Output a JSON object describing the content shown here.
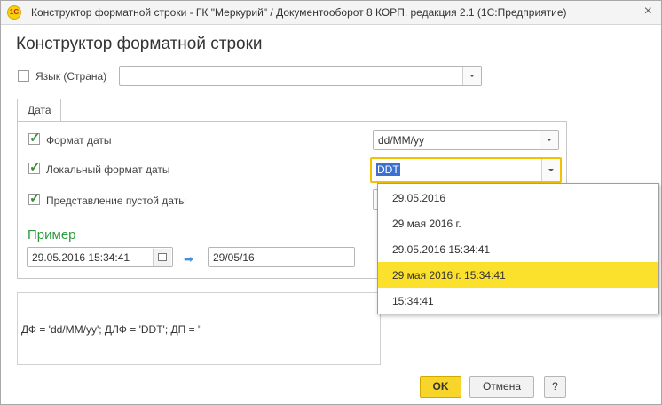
{
  "window": {
    "title": "Конструктор форматной строки - ГК \"Меркурий\" / Документооборот 8 КОРП, редакция 2.1  (1С:Предприятие)",
    "app_icon": "1С",
    "close_glyph": "×"
  },
  "form": {
    "title": "Конструктор форматной строки"
  },
  "language": {
    "label": "Язык (Страна)",
    "value": ""
  },
  "tabs": [
    {
      "label": "Дата"
    }
  ],
  "date_format": {
    "label": "Формат даты",
    "value": "dd/MM/yy",
    "checked": true
  },
  "local_date_format": {
    "label": "Локальный формат даты",
    "value": "DDT",
    "checked": true
  },
  "empty_date": {
    "label": "Представление пустой даты",
    "checked": true
  },
  "example": {
    "title": "Пример",
    "input_value": "29.05.2016 15:34:41",
    "output_value": "29/05/16"
  },
  "result": {
    "text": "ДФ = 'dd/MM/yy'; ДЛФ = 'DDT'; ДП = ''"
  },
  "buttons": {
    "ok": "OK",
    "cancel": "Отмена",
    "help": "?"
  },
  "dropdown": {
    "options": [
      "29.05.2016",
      "29 мая 2016 г.",
      "29.05.2016 15:34:41",
      "29 мая 2016 г. 15:34:41",
      "15:34:41"
    ],
    "selected_index": 3
  },
  "colors": {
    "accent": "#f7d52a",
    "example_green": "#2a9b3c",
    "highlight": "#fbe02c"
  }
}
